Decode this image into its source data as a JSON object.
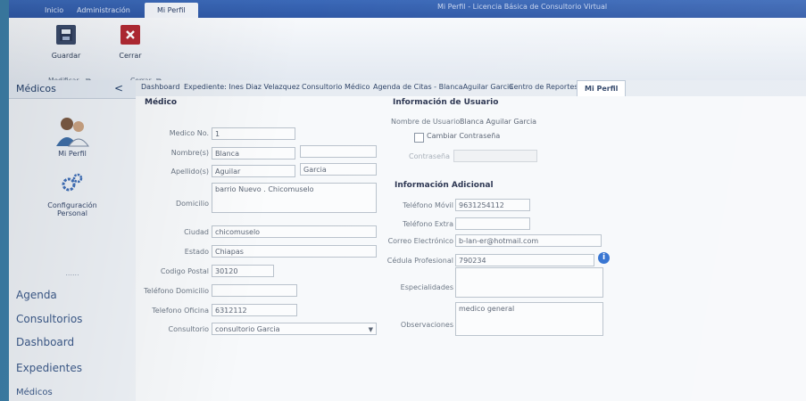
{
  "app": {
    "window_title": "Mi Perfil - Licencia Básica de Consultorio Virtual",
    "ribbon_tabs": [
      "Inicio",
      "Administración",
      "Mi Perfil"
    ],
    "colors": {
      "titlebar": "#2f58a6",
      "accent": "#24406b",
      "ribbon": "#eef2f7"
    }
  },
  "ribbon": {
    "save_label": "Guardar",
    "close_label": "Cerrar",
    "group_modify": "Modificar",
    "group_close": "Cerrar",
    "save_icon": "save-icon",
    "close_icon": "close-icon"
  },
  "sidebar": {
    "header": "Médicos",
    "collapse_glyph": "<",
    "profile_label": "Mi Perfil",
    "config_label_1": "Configuración",
    "config_label_2": "Personal",
    "dots": "......",
    "nav": [
      "Agenda",
      "Consultorios",
      "Dashboard",
      "Expedientes",
      "Médicos"
    ]
  },
  "doc_tabs": [
    "Dashboard",
    "Expediente: Ines Diaz Velazquez",
    "Consultorio Médico",
    "Agenda de Citas - BlancaAguilar Garcia",
    "Centro de Reportes",
    "Mi Perfil"
  ],
  "medico": {
    "section": "Médico",
    "medico_no_label": "Medico No.",
    "medico_no": "1",
    "nombres_label": "Nombre(s)",
    "nombre": "Blanca",
    "nombre2": "",
    "apellidos_label": "Apellido(s)",
    "apellido1": "Aguilar",
    "apellido2": "Garcia",
    "domicilio_label": "Domicilio",
    "domicilio": "barrio Nuevo . Chicomuselo",
    "ciudad_label": "Ciudad",
    "ciudad": "chicomuselo",
    "estado_label": "Estado",
    "estado": "Chiapas",
    "cp_label": "Codigo Postal",
    "cp": "30120",
    "tel_dom_label": "Teléfono Domicilio",
    "tel_dom": "",
    "tel_ofi_label": "Telefono Oficina",
    "tel_ofi": "6312112",
    "consultorio_label": "Consultorio",
    "consultorio": "consultorio Garcia"
  },
  "usuario": {
    "section": "Información de Usuario",
    "nombre_usuario_label": "Nombre de Usuario",
    "nombre_usuario": "Blanca Aguilar Garcia",
    "cambiar_label": "Cambiar Contraseña",
    "contrasena_label": "Contraseña",
    "contrasena": ""
  },
  "adicional": {
    "section": "Información Adicional",
    "movil_label": "Teléfono Móvil",
    "movil": "9631254112",
    "extra_label": "Teléfono Extra",
    "extra": "",
    "correo_label": "Correo Electrónico",
    "correo": "b-lan-er@hotmail.com",
    "cedula_label": "Cédula Profesional",
    "cedula": "790234",
    "especialidades_label": "Especialidades",
    "especialidades": "",
    "observaciones_label": "Observaciones",
    "observaciones": "medico general"
  }
}
